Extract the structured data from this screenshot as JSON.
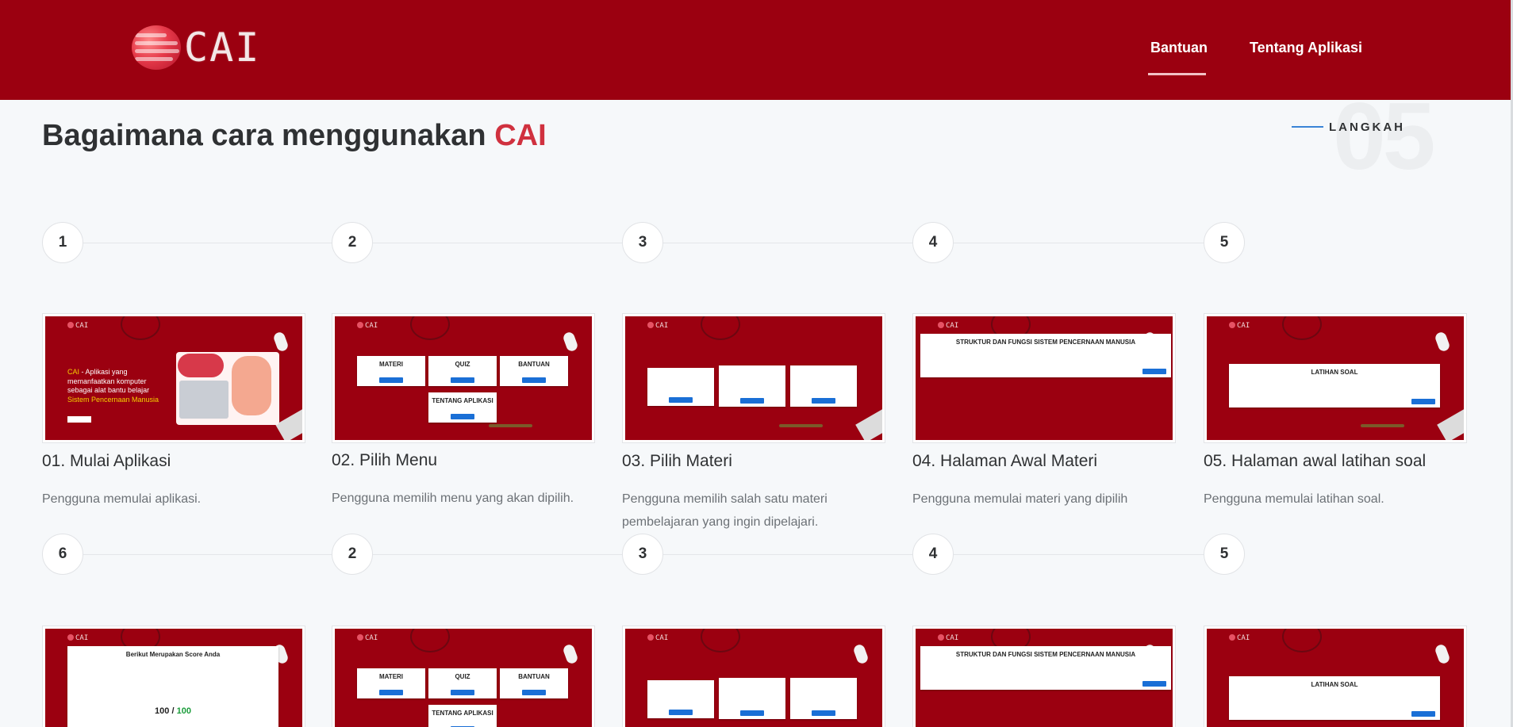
{
  "brand": {
    "logo_text": "CAI"
  },
  "nav": {
    "bantuan": "Bantuan",
    "tentang": "Tentang Aplikasi"
  },
  "heading": {
    "prefix": "Bagaimana cara menggunakan",
    "accent": "CAI"
  },
  "section": {
    "label": "LANGKAH",
    "big_number": "05"
  },
  "steps_row1": [
    {
      "num": "1",
      "title": "01. Mulai Aplikasi",
      "desc": "Pengguna memulai aplikasi."
    },
    {
      "num": "2",
      "title": "02. Pilih Menu",
      "desc": "Pengguna memilih menu yang akan dipilih."
    },
    {
      "num": "3",
      "title": "03. Pilih Materi",
      "desc": "Pengguna memilih salah satu materi pembelajaran yang ingin dipelajari."
    },
    {
      "num": "4",
      "title": "04. Halaman Awal Materi",
      "desc": "Pengguna memulai materi yang dipilih"
    },
    {
      "num": "5",
      "title": "05. Halaman awal latihan soal",
      "desc": "Pengguna memulai latihan soal."
    }
  ],
  "steps_row2": [
    {
      "num": "6"
    },
    {
      "num": "2"
    },
    {
      "num": "3"
    },
    {
      "num": "4"
    },
    {
      "num": "5"
    }
  ],
  "thumbs": {
    "mini_logo": "CAI",
    "hero_prefix": "CAI",
    "hero_text": " - Aplikasi yang memanfaatkan komputer sebagai alat bantu belajar",
    "hero_highlight": "Sistem Pencernaan Manusia",
    "menu": [
      "MATERI",
      "QUIZ",
      "BANTUAN",
      "TENTANG APLIKASI"
    ],
    "materi_title": "STRUKTUR DAN FUNGSI SISTEM PENCERNAAN MANUSIA",
    "latihan_title": "LATIHAN SOAL",
    "score_title": "Berikut Merupakan Score Anda",
    "score_value": "100",
    "score_sep": "/",
    "score_max": "100"
  }
}
